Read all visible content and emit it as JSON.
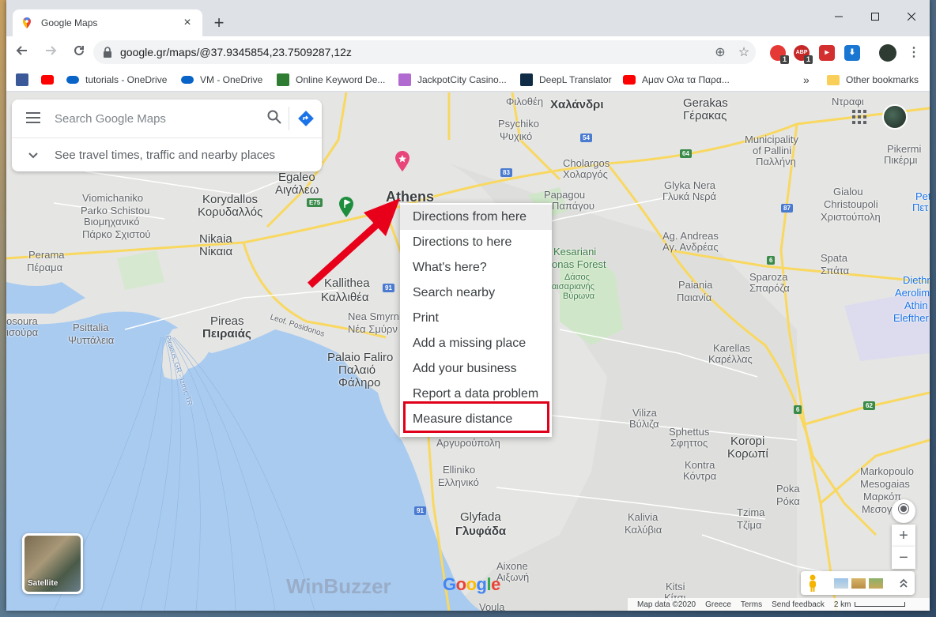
{
  "browser": {
    "tab_title": "Google Maps",
    "tab_close": "×",
    "new_tab": "+",
    "url": "google.gr/maps/@37.9345854,23.7509287,12z",
    "window_controls": {
      "minimize": "—",
      "maximize": "☐",
      "close": "✕"
    },
    "bookmarks": [
      {
        "label": "",
        "icon": "facebook-icon",
        "color": "#3b5998"
      },
      {
        "label": "",
        "icon": "youtube-icon",
        "color": "#ff0000"
      },
      {
        "label": "tutorials - OneDrive",
        "icon": "onedrive-icon",
        "color": "#0a64c8"
      },
      {
        "label": "VM - OneDrive",
        "icon": "onedrive-icon",
        "color": "#0a64c8"
      },
      {
        "label": "Online Keyword De...",
        "icon": "keyword-tool-icon",
        "color": "#2e7d32"
      },
      {
        "label": "JackpotCity Casino...",
        "icon": "jackpotcity-icon",
        "color": "#b06ad0"
      },
      {
        "label": "DeepL Translator",
        "icon": "deepl-icon",
        "color": "#0f2b46"
      },
      {
        "label": "Αμαν Ολα τα Παρα...",
        "icon": "youtube-icon",
        "color": "#ff0000"
      }
    ],
    "bookmarks_overflow": "»",
    "other_bookmarks": "Other bookmarks",
    "extension_badges": [
      "1",
      "1"
    ],
    "extension_abp": "ABP"
  },
  "maps": {
    "search_placeholder": "Search Google Maps",
    "travel_text": "See travel times, traffic and nearby places",
    "context_menu": [
      "Directions from here",
      "Directions to here",
      "What's here?",
      "Search nearby",
      "Print",
      "Add a missing place",
      "Add your business",
      "Report a data problem",
      "Measure distance"
    ],
    "satellite_label": "Satellite",
    "watermark": "WinBuzzer",
    "google_logo": [
      "G",
      "o",
      "o",
      "g",
      "l",
      "e"
    ],
    "google_logo_colors": [
      "#4285f4",
      "#ea4335",
      "#fbbc05",
      "#4285f4",
      "#34a853",
      "#ea4335"
    ],
    "zoom_in": "+",
    "zoom_out": "−",
    "footer": {
      "map_data": "Map data ©2020",
      "region": "Greece",
      "terms": "Terms",
      "feedback": "Send feedback",
      "scale": "2 km"
    },
    "places": [
      {
        "id": "filothei",
        "text": "Φιλοθέη"
      },
      {
        "id": "chalandri",
        "text": "Χαλάνδρι"
      },
      {
        "id": "gerakas-en",
        "text": "Gerakas"
      },
      {
        "id": "gerakas-gr",
        "text": "Γέρακας"
      },
      {
        "id": "ntrafi",
        "text": "Ντραφι"
      },
      {
        "id": "psychiko-en",
        "text": "Psychiko"
      },
      {
        "id": "psychiko-gr",
        "text": "Ψυχικό"
      },
      {
        "id": "pallini-en",
        "text": "Municipality"
      },
      {
        "id": "pallini-en2",
        "text": "of Pallini"
      },
      {
        "id": "pallini-gr",
        "text": "Παλλήνη"
      },
      {
        "id": "pikermi-en",
        "text": "Pikermi"
      },
      {
        "id": "pikermi-gr",
        "text": "Πικέρμι"
      },
      {
        "id": "cholargos-en",
        "text": "Cholargos"
      },
      {
        "id": "cholargos-gr",
        "text": "Χολαργός"
      },
      {
        "id": "glykanera-en",
        "text": "Glyka Nera"
      },
      {
        "id": "glykanera-gr",
        "text": "Γλυκά Νερά"
      },
      {
        "id": "egaleo-en",
        "text": "Egaleo"
      },
      {
        "id": "egaleo-gr",
        "text": "Αιγάλεω"
      },
      {
        "id": "viomichaniko",
        "text": "Viomichaniko"
      },
      {
        "id": "parko",
        "text": "Parko Schistou"
      },
      {
        "id": "viomich-gr",
        "text": "Βιομηχανικό"
      },
      {
        "id": "parko-gr",
        "text": "Πάρκο Σχιστού"
      },
      {
        "id": "korydallos-en",
        "text": "Korydallos"
      },
      {
        "id": "korydallos-gr",
        "text": "Κορυδαλλός"
      },
      {
        "id": "athens",
        "text": "Athens"
      },
      {
        "id": "papagou-en",
        "text": "Papagou"
      },
      {
        "id": "papagou-gr",
        "text": "Παπάγου"
      },
      {
        "id": "gialou-en",
        "text": "Gialou"
      },
      {
        "id": "christoupoli-en",
        "text": "Christoupoli"
      },
      {
        "id": "christoupoli-gr",
        "text": "Χριστούπολη"
      },
      {
        "id": "pet",
        "text": "Pet"
      },
      {
        "id": "pete",
        "text": "Πετ"
      },
      {
        "id": "nikaia-en",
        "text": "Nikaia"
      },
      {
        "id": "nikaia-gr",
        "text": "Νίκαια"
      },
      {
        "id": "kesariani",
        "text": "Kesariani"
      },
      {
        "id": "forest",
        "text": "onas Forest"
      },
      {
        "id": "dasos",
        "text": "Δάσος"
      },
      {
        "id": "kais",
        "text": "αισαριανής"
      },
      {
        "id": "vyrona",
        "text": "Βύρωνα"
      },
      {
        "id": "agandreas-en",
        "text": "Ag. Andreas"
      },
      {
        "id": "agandreas-gr",
        "text": "Αγ. Ανδρέας"
      },
      {
        "id": "perama-en",
        "text": "Perama"
      },
      {
        "id": "perama-gr",
        "text": "Πέραμα"
      },
      {
        "id": "spata-en",
        "text": "Spata"
      },
      {
        "id": "spata-gr",
        "text": "Σπάτα"
      },
      {
        "id": "kallithea-en",
        "text": "Kallithea"
      },
      {
        "id": "kallithea-gr",
        "text": "Καλλιθέα"
      },
      {
        "id": "sparoza-en",
        "text": "Sparoza"
      },
      {
        "id": "sparoza-gr",
        "text": "Σπαρόζα"
      },
      {
        "id": "paiania-en",
        "text": "Paiania"
      },
      {
        "id": "paiania-gr",
        "text": "Παιανία"
      },
      {
        "id": "diethn",
        "text": "Diethn"
      },
      {
        "id": "aerolim",
        "text": "Aerolim"
      },
      {
        "id": "athin",
        "text": "Athin"
      },
      {
        "id": "elefther",
        "text": "Elefther"
      },
      {
        "id": "perama2",
        "text": "osoura"
      },
      {
        "id": "perama3",
        "text": "ισούρα"
      },
      {
        "id": "pireas-en",
        "text": "Pireas"
      },
      {
        "id": "pireas-gr",
        "text": "Πειραιάς"
      },
      {
        "id": "psittalia-en",
        "text": "Psittalia"
      },
      {
        "id": "psittalia-gr",
        "text": "Ψυττάλεια"
      },
      {
        "id": "posidonos",
        "text": "Leof. Posidonos"
      },
      {
        "id": "neasmyrni-en",
        "text": "Nea Smyrni"
      },
      {
        "id": "neasmyrni-gr",
        "text": "Νέα Σμύρν"
      },
      {
        "id": "karellas-en",
        "text": "Karellas"
      },
      {
        "id": "karellas-gr",
        "text": "Καρέλλας"
      },
      {
        "id": "faliro-en",
        "text": "Palaio Faliro"
      },
      {
        "id": "faliro-gr",
        "text": "Παλαιό"
      },
      {
        "id": "faliro-gr2",
        "text": "Φάληρο"
      },
      {
        "id": "argyroupoli",
        "text": "Αργυρούπολη"
      },
      {
        "id": "viliza-en",
        "text": "Viliza"
      },
      {
        "id": "viliza-gr",
        "text": "Βύλιζα"
      },
      {
        "id": "sphettus-en",
        "text": "Sphettus"
      },
      {
        "id": "sphettus-gr",
        "text": "Σφηττος"
      },
      {
        "id": "koropi-en",
        "text": "Koropi"
      },
      {
        "id": "koropi-gr",
        "text": "Κορωπί"
      },
      {
        "id": "kontra-en",
        "text": "Kontra"
      },
      {
        "id": "kontra-gr",
        "text": "Κόντρα"
      },
      {
        "id": "elliniko-en",
        "text": "Elliniko"
      },
      {
        "id": "elliniko-gr",
        "text": "Ελληνικό"
      },
      {
        "id": "markopoulo-en",
        "text": "Markopoulo"
      },
      {
        "id": "markopoulo-en2",
        "text": "Mesogaias"
      },
      {
        "id": "markopoulo-gr",
        "text": "Μαρκόπ"
      },
      {
        "id": "markopoulo-gr2",
        "text": "Μεσογα"
      },
      {
        "id": "poka-en",
        "text": "Poka"
      },
      {
        "id": "poka-gr",
        "text": "Ρόκα"
      },
      {
        "id": "tzima-en",
        "text": "Tzima"
      },
      {
        "id": "tzima-gr",
        "text": "Τζίμα"
      },
      {
        "id": "glyfada-en",
        "text": "Glyfada"
      },
      {
        "id": "glyfada-gr",
        "text": "Γλυφάδα"
      },
      {
        "id": "kalivia-en",
        "text": "Kalivia"
      },
      {
        "id": "kalivia-gr",
        "text": "Καλύβια"
      },
      {
        "id": "kitsi-en",
        "text": "Kitsi"
      },
      {
        "id": "kitsi-gr",
        "text": "Κίτσι"
      },
      {
        "id": "aixoni-en",
        "text": "Aixone"
      },
      {
        "id": "aixoni-gr",
        "text": "Αιξωνή"
      },
      {
        "id": "voula",
        "text": "Voula"
      },
      {
        "id": "piraeus-route",
        "text": "Piraeus, GR - Izmir, TR"
      }
    ],
    "road_shields": [
      "54",
      "83",
      "64",
      "E75",
      "87",
      "6",
      "91",
      "6",
      "62",
      "91",
      "6"
    ]
  }
}
